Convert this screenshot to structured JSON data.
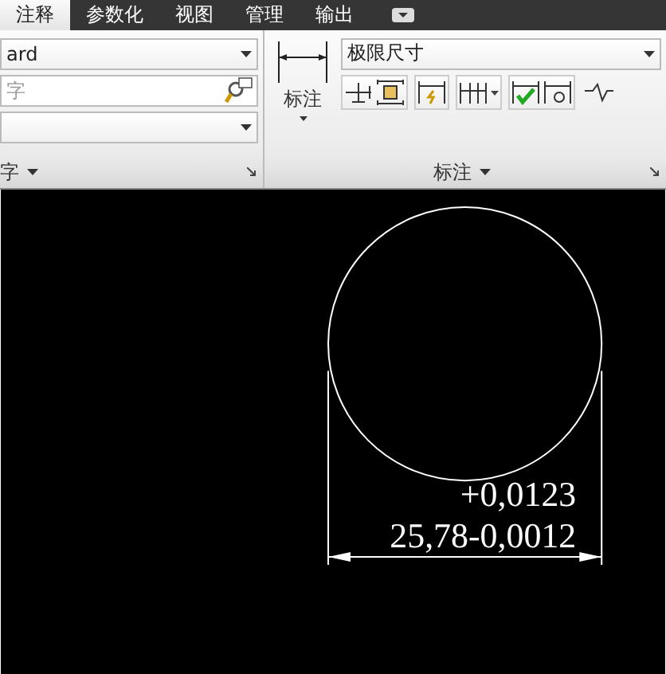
{
  "tabs": [
    {
      "label": "注释",
      "selected": true
    },
    {
      "label": "参数化",
      "selected": false
    },
    {
      "label": "视图",
      "selected": false
    },
    {
      "label": "管理",
      "selected": false
    },
    {
      "label": "输出",
      "selected": false
    }
  ],
  "text_panel": {
    "style_combo": {
      "value": "ard"
    },
    "search_field": {
      "placeholder": "字"
    },
    "title": "字"
  },
  "dimension_panel": {
    "button_label": "标注",
    "style_combo": {
      "value": "极限尺寸"
    },
    "title": "标注"
  },
  "drawing": {
    "upper_tolerance": "+0,0123",
    "dimension_text": "25,78-0,0012"
  }
}
